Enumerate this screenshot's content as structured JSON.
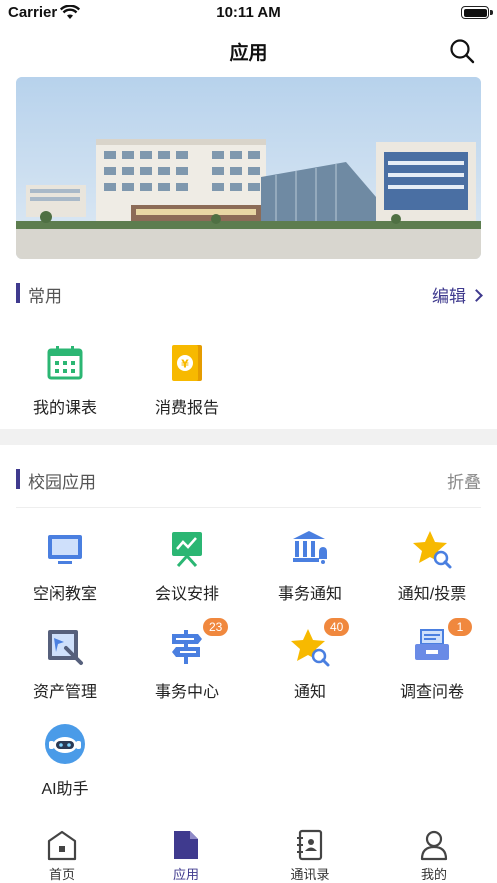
{
  "status_bar": {
    "carrier": "Carrier",
    "time": "10:11 AM"
  },
  "nav": {
    "title": "应用",
    "search_icon": "search-icon"
  },
  "banner": {
    "image": "campus-building-photo"
  },
  "common": {
    "title": "常用",
    "edit_label": "编辑",
    "items": [
      {
        "label": "我的课表",
        "icon": "calendar-icon",
        "color": "#2bb673"
      },
      {
        "label": "消费报告",
        "icon": "yuan-book-icon",
        "color": "#f5b800"
      }
    ]
  },
  "campus": {
    "title": "校园应用",
    "fold_label": "折叠",
    "items": [
      {
        "label": "空闲教室",
        "icon": "monitor-icon",
        "badge": ""
      },
      {
        "label": "会议安排",
        "icon": "presentation-board-icon",
        "badge": ""
      },
      {
        "label": "事务通知",
        "icon": "bank-bell-icon",
        "badge": ""
      },
      {
        "label": "通知/投票",
        "icon": "star-search-icon",
        "badge": ""
      },
      {
        "label": "资产管理",
        "icon": "asset-edit-icon",
        "badge": ""
      },
      {
        "label": "事务中心",
        "icon": "signpost-icon",
        "badge": "23"
      },
      {
        "label": "通知",
        "icon": "star-search-icon",
        "badge": "40"
      },
      {
        "label": "调查问卷",
        "icon": "printer-form-icon",
        "badge": "1"
      },
      {
        "label": "AI助手",
        "icon": "robot-icon",
        "badge": ""
      }
    ]
  },
  "tabs": [
    {
      "label": "首页",
      "icon": "home-icon",
      "active": false
    },
    {
      "label": "应用",
      "icon": "document-icon",
      "active": true
    },
    {
      "label": "通讯录",
      "icon": "contacts-book-icon",
      "active": false
    },
    {
      "label": "我的",
      "icon": "person-icon",
      "active": false
    }
  ],
  "colors": {
    "accent": "#3f3a8e",
    "badge": "#f0883e",
    "icon_blue": "#4a7fe0",
    "green": "#2bb673"
  }
}
